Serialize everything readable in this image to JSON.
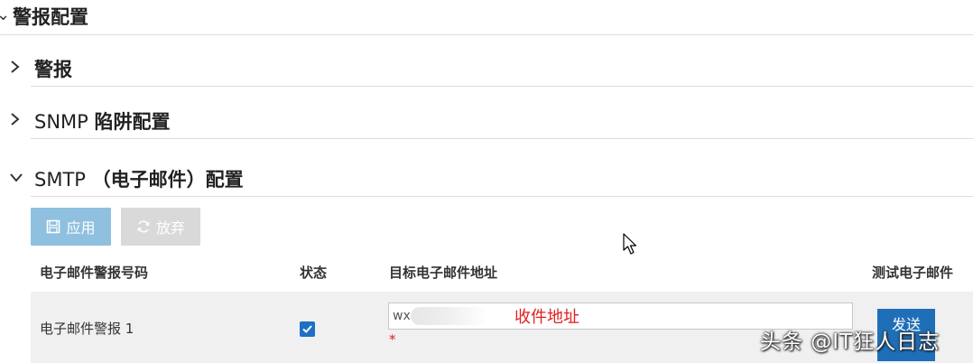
{
  "page": {
    "title": "警报配置"
  },
  "sections": [
    {
      "id": "alarm",
      "label": "警报",
      "expanded": false
    },
    {
      "id": "snmp",
      "label_prefix": "SNMP ",
      "label_bold": "陷阱配置",
      "expanded": false
    },
    {
      "id": "smtp",
      "label_prefix": "SMTP ",
      "label_bold": "（电子邮件）配置",
      "expanded": true
    }
  ],
  "toolbar": {
    "apply_label": "应用",
    "discard_label": "放弃"
  },
  "table": {
    "headers": [
      "电子邮件警报号码",
      "状态",
      "目标电子邮件地址",
      "测试电子邮件"
    ],
    "rows": [
      {
        "name": "电子邮件警报 1",
        "status_checked": true,
        "email_value": "wx",
        "annotation": "收件地址",
        "required_mark": "*",
        "send_label": "发送"
      }
    ]
  },
  "watermark": "头条 @IT狂人日志",
  "colors": {
    "apply_bg": "#8fc0e0",
    "discard_bg": "#d9d9d9",
    "send_bg": "#1f6fb8",
    "checkbox": "#1f6fc5",
    "annotation": "#e02020"
  }
}
